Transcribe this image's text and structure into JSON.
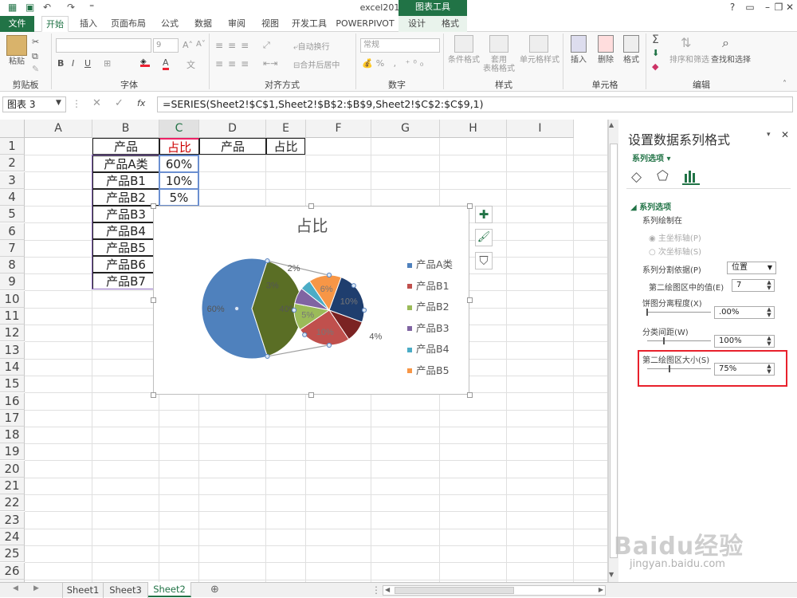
{
  "window": {
    "title": "excel2013 - Excel",
    "context_tab": "图表工具",
    "controls": [
      "?",
      "▭",
      "–",
      "❐",
      "✕"
    ]
  },
  "tabs": [
    "文件",
    "开始",
    "插入",
    "页面布局",
    "公式",
    "数据",
    "审阅",
    "视图",
    "开发工具",
    "POWERPIVOT",
    "设计",
    "格式"
  ],
  "ribbon": {
    "groups": [
      "剪贴板",
      "字体",
      "对齐方式",
      "数字",
      "样式",
      "单元格",
      "编辑"
    ],
    "paste": "粘贴",
    "font_size": "9",
    "wrap": "自动换行",
    "merge": "合并后居中",
    "number_format": "常规",
    "cond_format": "条件格式",
    "table_format": "套用\n表格格式",
    "cell_style": "单元格样式",
    "insert": "插入",
    "delete": "删除",
    "format": "格式",
    "sort": "排序和筛选",
    "find": "查找和选择"
  },
  "formula_bar": {
    "name_box": "图表 3",
    "fx": "fx",
    "formula": "=SERIES(Sheet2!$C$1,Sheet2!$B$2:$B$9,Sheet2!$C$2:$C$9,1)"
  },
  "grid": {
    "columns": [
      "A",
      "B",
      "C",
      "D",
      "E",
      "F",
      "G",
      "H",
      "I"
    ],
    "rows": [
      "1",
      "2",
      "3",
      "4",
      "5",
      "6",
      "7",
      "8",
      "9",
      "10",
      "11",
      "12",
      "13",
      "14",
      "15",
      "16",
      "17",
      "18",
      "19",
      "20",
      "21",
      "22",
      "23",
      "24",
      "25",
      "26",
      "27"
    ],
    "headers": {
      "b1": "产品",
      "c1": "占比",
      "d1": "产品",
      "e1": "占比"
    },
    "products": [
      "产品A类",
      "产品B1",
      "产品B2",
      "产品B3",
      "产品B4",
      "产品B5",
      "产品B6",
      "产品B7"
    ],
    "percents": [
      "60%",
      "10%",
      "5%"
    ]
  },
  "chart": {
    "title": "占比",
    "legend": [
      "产品A类",
      "产品B1",
      "产品B2",
      "产品B3",
      "产品B4",
      "产品B5"
    ],
    "primary_labels": [
      "60%",
      "40%"
    ],
    "secondary_labels": [
      "10%",
      "4%",
      "10%",
      "5%",
      "3%",
      "2%",
      "6%"
    ]
  },
  "chart_data": {
    "type": "pie",
    "subtype": "pie-of-pie",
    "title": "占比",
    "categories": [
      "产品A类",
      "产品B1",
      "产品B2",
      "产品B3",
      "产品B4",
      "产品B5",
      "产品B6",
      "产品B7"
    ],
    "legend_entries": [
      "产品A类",
      "产品B1",
      "产品B2",
      "产品B3",
      "产品B4",
      "产品B5"
    ],
    "legend": "right",
    "main_pie": [
      {
        "label": "60%",
        "value": 60,
        "color": "#4f81bd"
      },
      {
        "label": "40%",
        "value": 40,
        "color": "#5a6e25"
      }
    ],
    "secondary_pie": [
      {
        "label": "10%",
        "value": 10,
        "color": "#1f3e6e"
      },
      {
        "label": "4%",
        "value": 4,
        "color": "#7b2323"
      },
      {
        "label": "10%",
        "value": 10,
        "color": "#c0504d"
      },
      {
        "label": "5%",
        "value": 5,
        "color": "#9bbb59"
      },
      {
        "label": "3%",
        "value": 3,
        "color": "#8064a2"
      },
      {
        "label": "2%",
        "value": 2,
        "color": "#4bacc6"
      },
      {
        "label": "6%",
        "value": 6,
        "color": "#f79646"
      }
    ]
  },
  "colors": {
    "excel_green": "#217346",
    "highlight_red": "#e8212c",
    "series_A": "#4f81bd",
    "series_B1": "#c0504d",
    "series_B2": "#9bbb59",
    "series_B3": "#8064a2",
    "series_B4": "#4bacc6",
    "series_B5": "#f79646"
  },
  "pane": {
    "title": "设置数据系列格式",
    "close": "✕",
    "dropdown": "▾",
    "subtitle": "系列选项",
    "section": "系列选项",
    "plot_on": "系列绘制在",
    "primary_axis": "主坐标轴(P)",
    "secondary_axis": "次坐标轴(S)",
    "split_by": "系列分割依据(P)",
    "split_value": "位置",
    "second_values": "第二绘图区中的值(E)",
    "second_values_num": "7",
    "explosion": "饼图分离程度(X)",
    "explosion_value": ".00%",
    "gap": "分类间距(W)",
    "gap_value": "100%",
    "second_size": "第二绘图区大小(S)",
    "second_size_value": "75%"
  },
  "sheets": [
    "Sheet1",
    "Sheet3",
    "Sheet2"
  ],
  "watermark": {
    "line1": "Baidu经验",
    "line2": "jingyan.baidu.com"
  }
}
